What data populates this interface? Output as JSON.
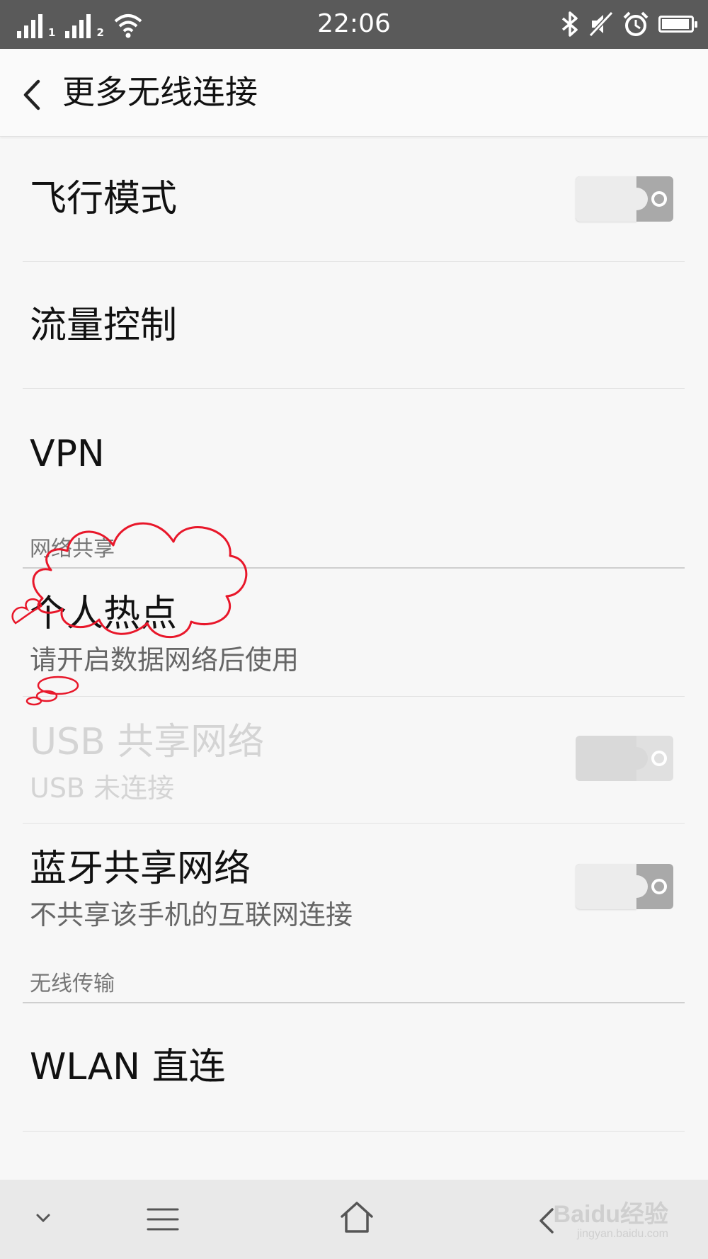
{
  "status_bar": {
    "time": "22:06",
    "sim1": "1",
    "sim2": "2",
    "battery_level": 0.95
  },
  "header": {
    "title": "更多无线连接"
  },
  "items": {
    "airplane": {
      "title": "飞行模式",
      "toggle_on": false
    },
    "data_control": {
      "title": "流量控制"
    },
    "vpn": {
      "title": "VPN"
    },
    "hotspot": {
      "title": "个人热点",
      "subtitle": "请开启数据网络后使用"
    },
    "usb": {
      "title": "USB 共享网络",
      "subtitle": "USB 未连接",
      "enabled": false,
      "toggle_on": false
    },
    "bt": {
      "title": "蓝牙共享网络",
      "subtitle": "不共享该手机的互联网连接",
      "toggle_on": false
    },
    "wlan_direct": {
      "title": "WLAN 直连"
    }
  },
  "sections": {
    "tethering": "网络共享",
    "wireless_transfer": "无线传输"
  },
  "watermark": {
    "brand": "Baidu经验",
    "url": "jingyan.baidu.com"
  },
  "colors": {
    "status_bar": "#5a5a5a",
    "annotation": "#e8172a"
  }
}
